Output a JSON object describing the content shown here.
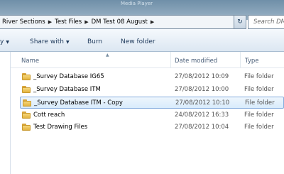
{
  "window": {
    "ghost_title": "Media Player"
  },
  "address_bar": {
    "crumbs": [
      "River Sections",
      "Test Files",
      "DM Test 08 August"
    ],
    "separator": "▶",
    "dropdown": "▾"
  },
  "nav_button_glyph": "↻",
  "search": {
    "placeholder": "Search DM"
  },
  "toolbar": {
    "organize_label": "y",
    "share_label": "Share with",
    "burn_label": "Burn",
    "new_folder_label": "New folder",
    "dropdown_glyph": "▼"
  },
  "columns": {
    "name": "Name",
    "date": "Date modified",
    "type": "Type",
    "sort_glyph": "▲"
  },
  "rows": [
    {
      "name": "_Survey Database IG65",
      "date": "27/08/2012 10:09",
      "type": "File folder",
      "selected": false,
      "icon": "folder-icon"
    },
    {
      "name": "_Survey Database ITM",
      "date": "27/08/2012 10:00",
      "type": "File folder",
      "selected": false,
      "icon": "folder-icon"
    },
    {
      "name": "_Survey Database ITM - Copy",
      "date": "27/08/2012 10:10",
      "type": "File folder",
      "selected": true,
      "icon": "folder-icon"
    },
    {
      "name": "Cott reach",
      "date": "24/08/2012 16:33",
      "type": "File folder",
      "selected": false,
      "icon": "folder-icon"
    },
    {
      "name": "Test Drawing Files",
      "date": "27/08/2012 10:04",
      "type": "File folder",
      "selected": false,
      "icon": "folder-icon"
    }
  ]
}
